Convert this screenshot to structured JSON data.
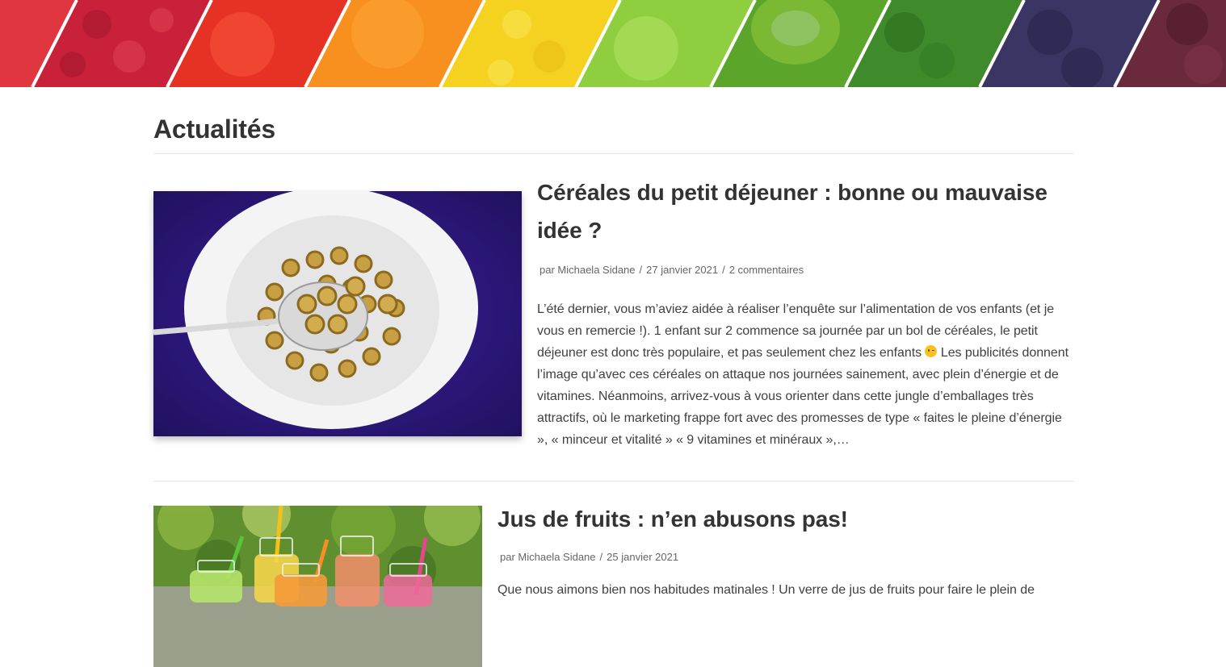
{
  "banner": {
    "icon": "fruits-vegetables-banner"
  },
  "page": {
    "title": "Actualités"
  },
  "posts": [
    {
      "title": "Céréales du petit déjeuner : bonne ou mauvaise idée ?",
      "author": "par Michaela Sidane",
      "date": "27 janvier 2021",
      "comments": "2 commentaires",
      "excerpt_part1": "L’été dernier, vous m’aviez aidée à réaliser l’enquête sur l’alimentation de vos enfants (et je vous en remercie !). 1 enfant sur 2 commence sa journée par un bol de céréales, le petit déjeuner est donc très populaire, et pas seulement chez les enfants",
      "excerpt_part2": " Les publicités donnent l’image qu’avec ces céréales on attaque nos journées sainement, avec plein d’énergie et de vitamines. Néanmoins, arrivez-vous à vous orienter dans cette jungle d’emballages très attractifs, où le marketing frappe fort avec des promesses de type « faites le pleine d’énergie », « minceur et vitalité » « 9 vitamines et minéraux »,…",
      "image": "cereal-bowl-image"
    },
    {
      "title": "Jus de fruits : n’en abusons pas!",
      "author": "par Michaela Sidane",
      "date": "25 janvier 2021",
      "excerpt": "Que nous aimons bien nos habitudes matinales ! Un verre de jus de fruits pour faire le plein de",
      "image": "fruit-juice-jars-image"
    }
  ]
}
